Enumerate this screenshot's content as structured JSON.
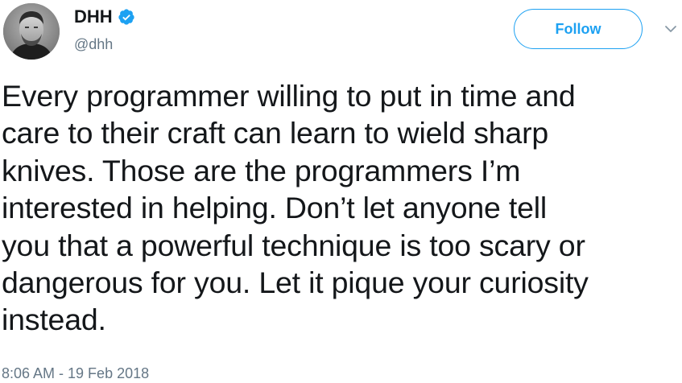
{
  "author": {
    "display_name": "DHH",
    "handle": "@dhh",
    "verified": true,
    "avatar_icon": "profile-photo"
  },
  "actions": {
    "follow_label": "Follow",
    "menu_icon": "chevron-down-icon"
  },
  "tweet": {
    "text_lines": [
      "Every programmer willing to put in time and",
      "care to their craft can learn to wield sharp",
      "knives. Those are the programmers I’m",
      "interested in helping. Don’t let anyone tell",
      "you that a powerful technique is too scary or",
      "dangerous for you. Let it pique your curiosity",
      "instead."
    ],
    "timestamp": "8:06 AM - 19 Feb 2018"
  },
  "colors": {
    "accent": "#1da1f2",
    "text": "#14171a",
    "secondary_text": "#657786"
  }
}
